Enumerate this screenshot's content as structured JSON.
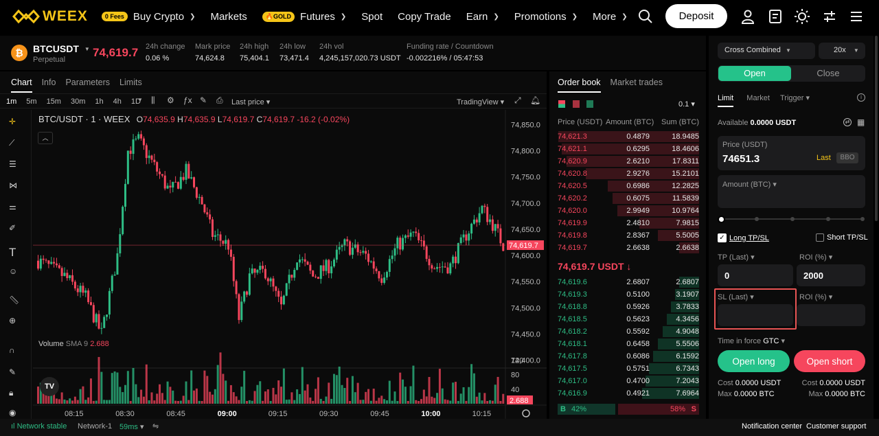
{
  "brand": {
    "name": "WEEX",
    "color": "#f5c518"
  },
  "nav": {
    "buy_crypto_badge": "0 Fees",
    "buy_crypto": "Buy Crypto",
    "markets": "Markets",
    "futures_badge": "GOLD",
    "futures": "Futures",
    "spot": "Spot",
    "copy_trade": "Copy Trade",
    "earn": "Earn",
    "promotions": "Promotions",
    "more": "More",
    "deposit": "Deposit"
  },
  "ticker": {
    "symbol": "BTCUSDT",
    "type": "Perpetual",
    "last_price": "74,619.7",
    "change_label": "24h change",
    "change_value": "0.06 %",
    "mark_label": "Mark price",
    "mark_value": "74,624.8",
    "high_label": "24h high",
    "high_value": "75,404.1",
    "low_label": "24h low",
    "low_value": "73,471.4",
    "vol_label": "24h vol",
    "vol_value": "4,245,157,020.73 USDT",
    "funding_label": "Funding rate / Countdown",
    "funding_value": "-0.002216% / 05:47:53"
  },
  "chart_tabs": [
    "Chart",
    "Info",
    "Parameters",
    "Limits"
  ],
  "timeframes": [
    "1m",
    "5m",
    "15m",
    "30m",
    "1h",
    "4h",
    "1D"
  ],
  "chart_toolbar": {
    "last_price": "Last price",
    "tradingview": "TradingView"
  },
  "chart_legend": {
    "pair": "BTC/USDT · 1 · WEEX",
    "o_label": "O",
    "o": "74,635.9",
    "h_label": "H",
    "h": "74,635.9",
    "l_label": "L",
    "l": "74,619.7",
    "c_label": "C",
    "c": "74,619.7",
    "chg": "-16.2 (-0.02%)"
  },
  "volume_legend": {
    "label": "Volume",
    "sma": "SMA 9",
    "value": "2.688"
  },
  "price_axis": [
    "74,850.0",
    "74,800.0",
    "74,750.0",
    "74,700.0",
    "74,650.0",
    "74,600.0",
    "74,550.0",
    "74,500.0",
    "74,450.0",
    "74,400.0"
  ],
  "current_price_tag": "74,619.7",
  "volume_axis": [
    "120",
    "80",
    "40"
  ],
  "volume_tag": "2.688",
  "time_axis": [
    "08:15",
    "08:30",
    "08:45",
    "09:00",
    "09:15",
    "09:30",
    "09:45",
    "10:00",
    "10:15"
  ],
  "chart_data": {
    "type": "candlestick",
    "ylim": [
      74380,
      74870
    ],
    "volume_ylim": [
      0,
      140
    ]
  },
  "orderbook": {
    "tabs": [
      "Order book",
      "Market trades"
    ],
    "precision": "0.1",
    "headers": [
      "Price (USDT)",
      "Amount (BTC)",
      "Sum (BTC)"
    ],
    "asks": [
      [
        "74,621.3",
        "0.4879",
        "18.9485"
      ],
      [
        "74,621.1",
        "0.6295",
        "18.4606"
      ],
      [
        "74,620.9",
        "2.6210",
        "17.8311"
      ],
      [
        "74,620.8",
        "2.9276",
        "15.2101"
      ],
      [
        "74,620.5",
        "0.6986",
        "12.2825"
      ],
      [
        "74,620.2",
        "0.6075",
        "11.5839"
      ],
      [
        "74,620.0",
        "2.9949",
        "10.9764"
      ],
      [
        "74,619.9",
        "2.4810",
        "7.9815"
      ],
      [
        "74,619.8",
        "2.8367",
        "5.5005"
      ],
      [
        "74,619.7",
        "2.6638",
        "2.6638"
      ]
    ],
    "mid": "74,619.7 USDT",
    "bids": [
      [
        "74,619.6",
        "2.6807",
        "2.6807"
      ],
      [
        "74,619.3",
        "0.5100",
        "3.1907"
      ],
      [
        "74,618.8",
        "0.5926",
        "3.7833"
      ],
      [
        "74,618.5",
        "0.5623",
        "4.3456"
      ],
      [
        "74,618.2",
        "0.5592",
        "4.9048"
      ],
      [
        "74,618.1",
        "0.6458",
        "5.5506"
      ],
      [
        "74,617.8",
        "0.6086",
        "6.1592"
      ],
      [
        "74,617.5",
        "0.5751",
        "6.7343"
      ],
      [
        "74,617.0",
        "0.4700",
        "7.2043"
      ],
      [
        "74,616.9",
        "0.4921",
        "7.6964"
      ]
    ],
    "buy_label": "B",
    "buy_pct": "42%",
    "sell_label": "S",
    "sell_pct": "58%"
  },
  "trade": {
    "margin_mode": "Cross Combined",
    "leverage": "20x",
    "open": "Open",
    "close": "Close",
    "order_types": [
      "Limit",
      "Market",
      "Trigger"
    ],
    "available_label": "Available",
    "available_value": "0.0000 USDT",
    "price_label": "Price (USDT)",
    "price_value": "74651.3",
    "last": "Last",
    "bbo": "BBO",
    "amount_label": "Amount (BTC)",
    "long_tpsl": "Long TP/SL",
    "short_tpsl": "Short TP/SL",
    "tp_label": "TP (Last)",
    "tp_value": "0",
    "roi_label": "ROI (%)",
    "roi_value": "2000",
    "sl_label": "SL (Last)",
    "roi2_label": "ROI (%)",
    "tif_label": "Time in force",
    "tif_value": "GTC",
    "open_long": "Open long",
    "open_short": "Open short",
    "cost_label": "Cost",
    "cost_value": "0.0000 USDT",
    "max_label": "Max",
    "max_value": "0.0000 BTC",
    "cost2_value": "0.0000 USDT",
    "max2_value": "0.0000 BTC"
  },
  "footer": {
    "network_stable": "Network stable",
    "network": "Network-1",
    "latency": "59ms",
    "notification": "Notification center",
    "support": "Customer support"
  },
  "colors": {
    "up": "#2ebd85",
    "down": "#f6465d",
    "accent": "#f5c518",
    "open_tab": "#25c28a"
  }
}
